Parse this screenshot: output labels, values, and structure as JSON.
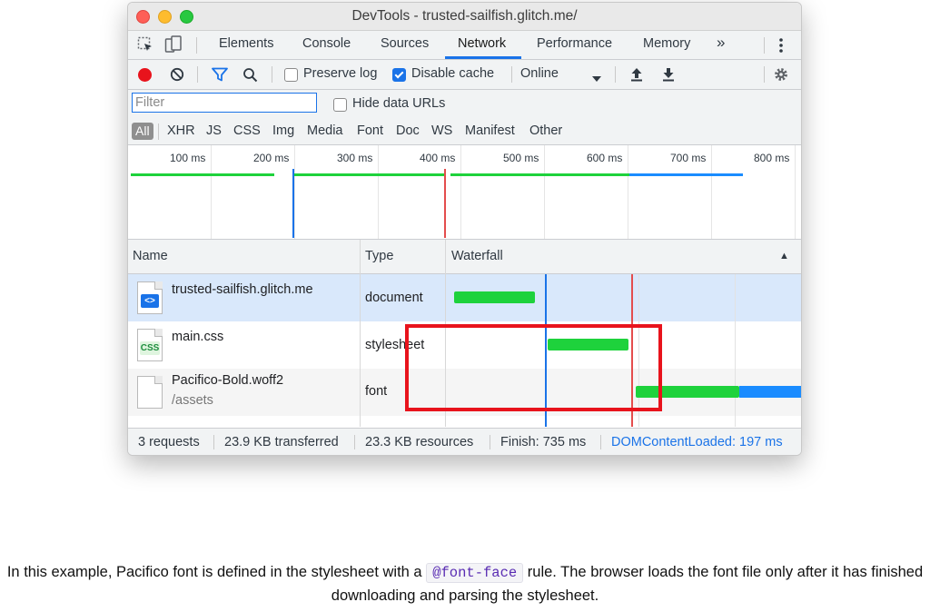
{
  "window": {
    "title": "DevTools - trusted-sailfish.glitch.me/"
  },
  "tabs": [
    {
      "label": "Elements"
    },
    {
      "label": "Console"
    },
    {
      "label": "Sources"
    },
    {
      "label": "Network",
      "active": true
    },
    {
      "label": "Performance"
    },
    {
      "label": "Memory"
    }
  ],
  "tabs_more": "»",
  "toolbar": {
    "preserve_log": "Preserve log",
    "preserve_log_checked": false,
    "disable_cache": "Disable cache",
    "disable_cache_checked": true,
    "throttling": "Online"
  },
  "filter": {
    "placeholder": "Filter",
    "hide_data_urls": "Hide data URLs"
  },
  "type_filters": [
    "All",
    "XHR",
    "JS",
    "CSS",
    "Img",
    "Media",
    "Font",
    "Doc",
    "WS",
    "Manifest",
    "Other"
  ],
  "overview": {
    "ticks": [
      "100 ms",
      "200 ms",
      "300 ms",
      "400 ms",
      "500 ms",
      "600 ms",
      "700 ms",
      "800 ms"
    ]
  },
  "table": {
    "headers": {
      "name": "Name",
      "type": "Type",
      "waterfall": "Waterfall",
      "sort_icon": "▲"
    },
    "rows": [
      {
        "name": "trusted-sailfish.glitch.me",
        "path": "",
        "type": "document",
        "icon": "html-file-icon",
        "icon_label": "<>"
      },
      {
        "name": "main.css",
        "path": "",
        "type": "stylesheet",
        "icon": "css-file-icon",
        "icon_label": "CSS"
      },
      {
        "name": "Pacifico-Bold.woff2",
        "path": "/assets",
        "type": "font",
        "icon": "font-file-icon",
        "icon_label": ""
      }
    ]
  },
  "status": {
    "requests": "3 requests",
    "transferred": "23.9 KB transferred",
    "resources": "23.3 KB resources",
    "finish": "Finish: 735 ms",
    "dom_content_loaded": "DOMContentLoaded: 197 ms"
  },
  "caption": {
    "before": "In this example, Pacifico font is defined in the stylesheet with a",
    "code": "@font-face",
    "after": "rule. The browser loads the font file only after it has finished downloading and parsing the stylesheet."
  },
  "colors": {
    "accent": "#1a73e8",
    "record": "#e8131c",
    "download": "#1ed23c",
    "waiting": "#1a8cff",
    "load_marker": "#e44d4d",
    "highlight": "#e8131c"
  }
}
